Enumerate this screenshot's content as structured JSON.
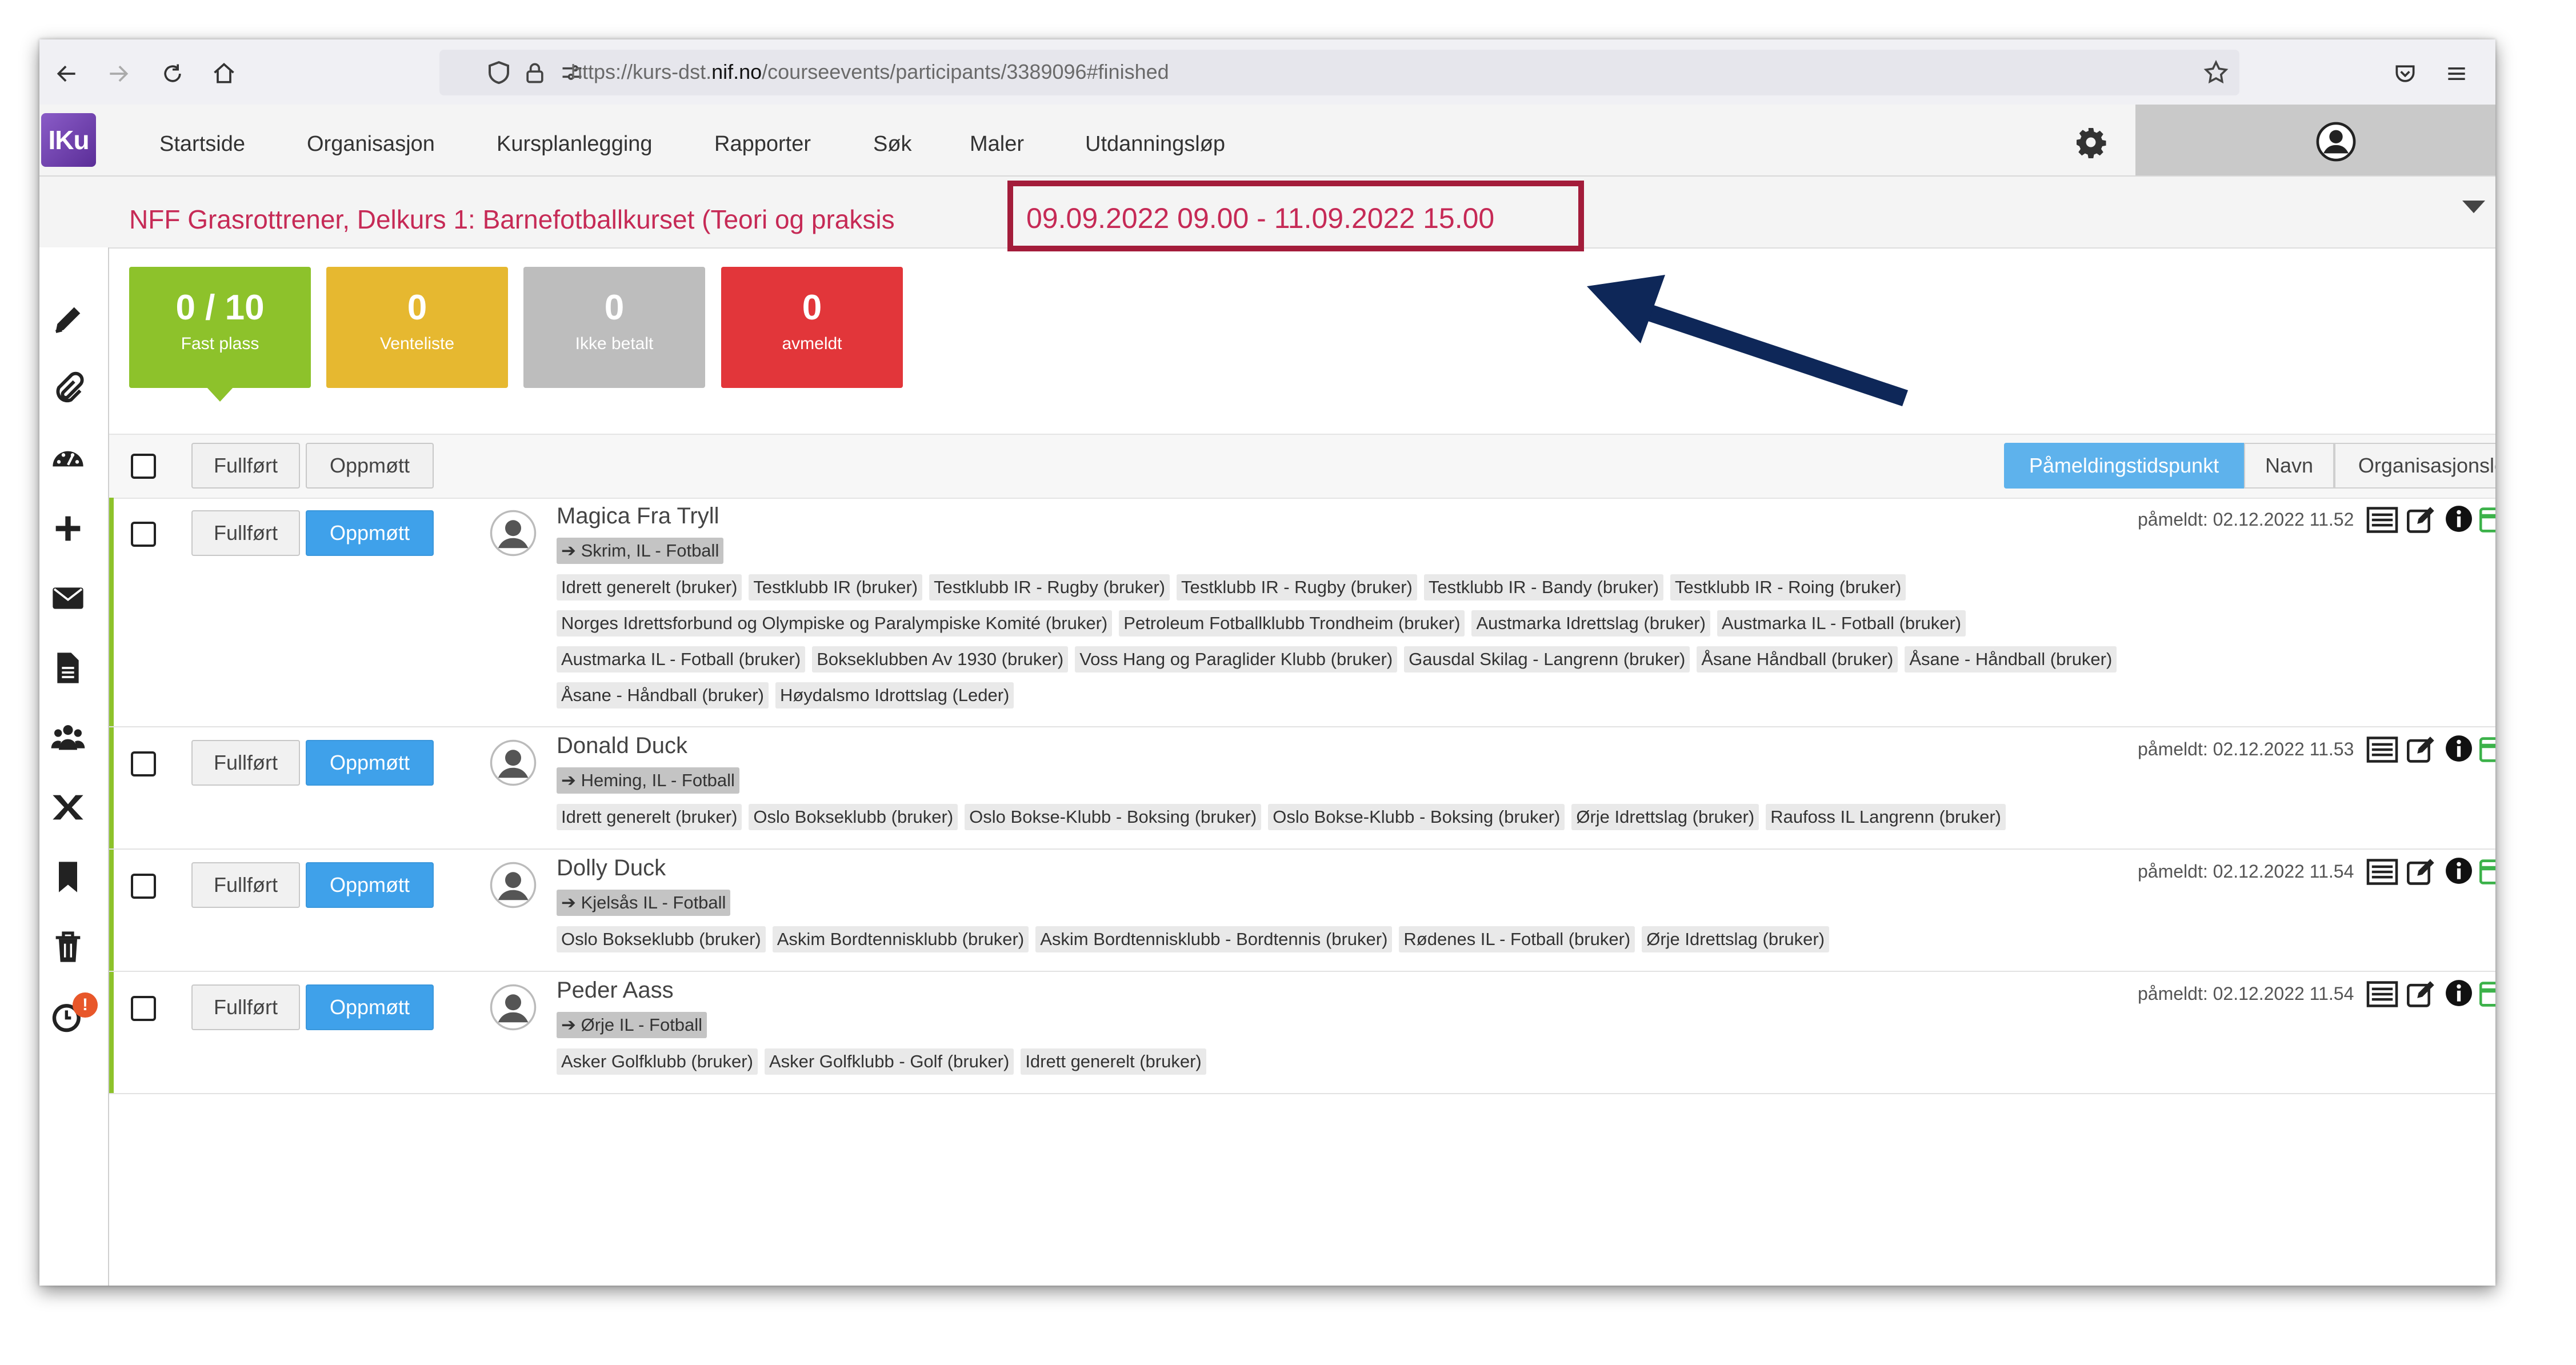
{
  "browser": {
    "url_prefix": "https://kurs-dst.",
    "url_domain": "nif.no",
    "url_path": "/courseevents/participants/3389096#finished"
  },
  "nav": {
    "logo": "IKu",
    "items": [
      "Startside",
      "Organisasjon",
      "Kursplanlegging",
      "Rapporter",
      "Søk",
      "Maler",
      "Utdanningsløp"
    ]
  },
  "course": {
    "title": "NFF Grasrottrener, Delkurs 1: Barnefotballkurset (Teori og praksis",
    "dates": "09.09.2022 09.00 - 11.09.2022 15.00"
  },
  "stats": [
    {
      "value": "0 / 10",
      "label": "Fast plass",
      "color": "#8dc22b"
    },
    {
      "value": "0",
      "label": "Venteliste",
      "color": "#e6b830"
    },
    {
      "value": "0",
      "label": "Ikke betalt",
      "color": "#bdbdbd"
    },
    {
      "value": "0",
      "label": "avmeldt",
      "color": "#e2363a"
    }
  ],
  "toolbar": {
    "completed_label": "Fullført",
    "attended_label": "Oppmøtt",
    "sort_options": [
      "Påmeldingstidspunkt",
      "Navn",
      "Organisasjonsledd"
    ],
    "sort_active": "Påmeldingstidspunkt"
  },
  "participants": [
    {
      "name": "Magica Fra Tryll",
      "club": "Skrim, IL - Fotball",
      "registered": "påmeldt: 02.12.2022 11.52",
      "tag_lines": [
        [
          "Idrett generelt (bruker)",
          "Testklubb IR (bruker)",
          "Testklubb IR - Rugby (bruker)",
          "Testklubb IR - Rugby (bruker)",
          "Testklubb IR - Bandy (bruker)",
          "Testklubb IR - Roing (bruker)"
        ],
        [
          "Norges Idrettsforbund og Olympiske og Paralympiske Komité (bruker)",
          "Petroleum Fotballklubb Trondheim (bruker)",
          "Austmarka Idrettslag (bruker)",
          "Austmarka IL - Fotball (bruker)"
        ],
        [
          "Austmarka IL - Fotball (bruker)",
          "Bokseklubben Av 1930 (bruker)",
          "Voss Hang og Paraglider Klubb (bruker)",
          "Gausdal Skilag - Langrenn (bruker)",
          "Åsane Håndball (bruker)",
          "Åsane - Håndball (bruker)"
        ],
        [
          "Åsane - Håndball (bruker)",
          "Høydalsmo Idrottslag (Leder)"
        ]
      ]
    },
    {
      "name": "Donald Duck",
      "club": "Heming, IL - Fotball",
      "registered": "påmeldt: 02.12.2022 11.53",
      "tag_lines": [
        [
          "Idrett generelt (bruker)",
          "Oslo Bokseklubb (bruker)",
          "Oslo Bokse-Klubb - Boksing (bruker)",
          "Oslo Bokse-Klubb - Boksing (bruker)",
          "Ørje Idrettslag (bruker)",
          "Raufoss IL Langrenn (bruker)"
        ]
      ]
    },
    {
      "name": "Dolly Duck",
      "club": "Kjelsås IL - Fotball",
      "registered": "påmeldt: 02.12.2022 11.54",
      "tag_lines": [
        [
          "Oslo Bokseklubb (bruker)",
          "Askim Bordtennisklubb (bruker)",
          "Askim Bordtennisklubb - Bordtennis (bruker)",
          "Rødenes IL - Fotball (bruker)",
          "Ørje Idrettslag (bruker)"
        ]
      ]
    },
    {
      "name": "Peder Aass",
      "club": "Ørje IL - Fotball",
      "registered": "påmeldt: 02.12.2022 11.54",
      "tag_lines": [
        [
          "Asker Golfklubb (bruker)",
          "Asker Golfklubb - Golf (bruker)",
          "Idrett generelt (bruker)"
        ]
      ]
    }
  ],
  "icons": {
    "sidebar": [
      "pencil-icon",
      "paperclip-icon",
      "dashboard-icon",
      "plus-icon",
      "envelope-icon",
      "document-icon",
      "group-icon",
      "excel-icon",
      "bookmark-icon",
      "trash-icon",
      "clock-alert-icon"
    ],
    "row_actions": [
      "list-icon",
      "edit-icon",
      "info-icon",
      "card-icon"
    ],
    "alert_badge": "!"
  }
}
